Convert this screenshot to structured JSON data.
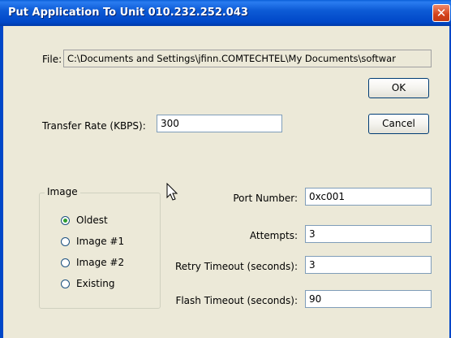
{
  "window": {
    "title": "Put Application To Unit 010.232.252.043",
    "close_glyph": "✕"
  },
  "file": {
    "label": "File:",
    "value": "C:\\Documents and Settings\\jfinn.COMTECHTEL\\My Documents\\softwar"
  },
  "buttons": {
    "ok": "OK",
    "cancel": "Cancel"
  },
  "transfer_rate": {
    "label": "Transfer Rate (KBPS):",
    "value": "300"
  },
  "image_group": {
    "legend": "Image",
    "options": [
      {
        "label": "Oldest",
        "selected": true
      },
      {
        "label": "Image #1",
        "selected": false
      },
      {
        "label": "Image #2",
        "selected": false
      },
      {
        "label": "Existing",
        "selected": false
      }
    ]
  },
  "settings": {
    "port_number": {
      "label": "Port Number:",
      "value": "0xc001"
    },
    "attempts": {
      "label": "Attempts:",
      "value": "3"
    },
    "retry_timeout": {
      "label": "Retry Timeout (seconds):",
      "value": "3"
    },
    "flash_timeout": {
      "label": "Flash Timeout (seconds):",
      "value": "90"
    }
  },
  "colors": {
    "titlebar": "#0047c8",
    "dialog_bg": "#ece9d8",
    "close_button": "#d4421a",
    "radio_selected": "#2f9d2f"
  },
  "icons": {
    "close": "close-icon",
    "cursor": "mouse-pointer-icon"
  }
}
